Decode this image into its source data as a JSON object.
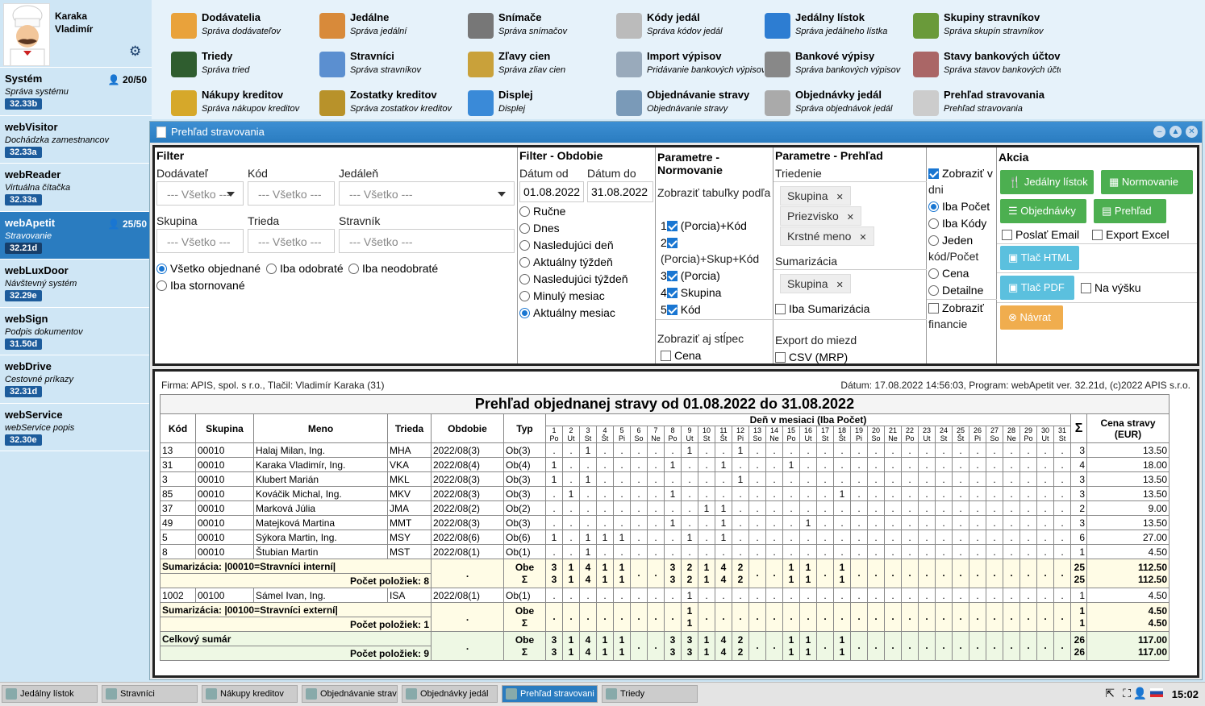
{
  "user": {
    "name1": "Karaka",
    "name2": "Vladimír"
  },
  "systems": [
    {
      "title": "Systém",
      "desc": "Správa systému",
      "ver": "32.33b",
      "count": "20/50"
    },
    {
      "title": "webVisitor",
      "desc": "Dochádzka zamestnancov",
      "ver": "32.33a",
      "count": ""
    },
    {
      "title": "webReader",
      "desc": "Virtuálna čítačka",
      "ver": "32.33a",
      "count": ""
    },
    {
      "title": "webApetit",
      "desc": "Stravovanie",
      "ver": "32.21d",
      "count": "25/50"
    },
    {
      "title": "webLuxDoor",
      "desc": "Návštevný systém",
      "ver": "32.29e",
      "count": ""
    },
    {
      "title": "webSign",
      "desc": "Podpis dokumentov",
      "ver": "31.50d",
      "count": ""
    },
    {
      "title": "webDrive",
      "desc": "Cestovné príkazy",
      "ver": "32.31d",
      "count": ""
    },
    {
      "title": "webService",
      "desc": "webService popis",
      "ver": "32.30e",
      "count": ""
    }
  ],
  "menu": [
    {
      "t": "Dodávatelia",
      "s": "Správa dodávateľov",
      "c": "#e9a23b"
    },
    {
      "t": "Jedálne",
      "s": "Správa jedální",
      "c": "#d88a3a"
    },
    {
      "t": "Snímače",
      "s": "Správa snímačov",
      "c": "#777"
    },
    {
      "t": "Kódy jedál",
      "s": "Správa kódov jedál",
      "c": "#bbb"
    },
    {
      "t": "Jedálny lístok",
      "s": "Správa jedálneho lístka",
      "c": "#2d7dd2"
    },
    {
      "t": "Skupiny stravníkov",
      "s": "Správa skupín stravníkov",
      "c": "#6a9a3a"
    },
    {
      "t": "Triedy",
      "s": "Správa tried",
      "c": "#2f5d2f"
    },
    {
      "t": "Stravníci",
      "s": "Správa stravníkov",
      "c": "#5b8fd0"
    },
    {
      "t": "Zľavy cien",
      "s": "Správa zliav cien",
      "c": "#c9a13a"
    },
    {
      "t": "Import výpisov",
      "s": "Pridávanie bankových výpisov",
      "c": "#9ab"
    },
    {
      "t": "Bankové výpisy",
      "s": "Správa bankových výpisov",
      "c": "#888"
    },
    {
      "t": "Stavy bankových účtov",
      "s": "Správa stavov bankových účtov",
      "c": "#a66"
    },
    {
      "t": "Nákupy kreditov",
      "s": "Správa nákupov kreditov",
      "c": "#d6a82a"
    },
    {
      "t": "Zostatky kreditov",
      "s": "Správa zostatkov kreditov",
      "c": "#b8922a"
    },
    {
      "t": "Displej",
      "s": "Displej",
      "c": "#3a8ad8"
    },
    {
      "t": "Objednávanie stravy",
      "s": "Objednávanie stravy",
      "c": "#7a9ab8"
    },
    {
      "t": "Objednávky jedál",
      "s": "Správa objednávok jedál",
      "c": "#aaa"
    },
    {
      "t": "Prehľad stravovania",
      "s": "Prehľad stravovania",
      "c": "#ccc"
    }
  ],
  "window": {
    "title": "Prehľad stravovania"
  },
  "filter": {
    "header": "Filter",
    "l_dod": "Dodávateľ",
    "l_kod": "Kód",
    "l_jed": "Jedáleň",
    "l_skup": "Skupina",
    "l_trieda": "Trieda",
    "l_strav": "Stravník",
    "all": "--- Všetko ---",
    "r1": "Všetko objednané",
    "r2": "Iba odobraté",
    "r3": "Iba neodobraté",
    "r4": "Iba stornované"
  },
  "obdobie": {
    "header": "Filter - Obdobie",
    "l_od": "Dátum od",
    "l_do": "Dátum do",
    "od": "01.08.2022",
    "do": "31.08.2022",
    "opts": [
      "Ručne",
      "Dnes",
      "Nasledujúci deň",
      "Aktuálny týždeň",
      "Nasledujúci týždeň",
      "Minulý mesiac",
      "Aktuálny mesiac"
    ]
  },
  "norm": {
    "header1": "Parametre -",
    "header2": "Normovanie",
    "l_tab": "Zobraziť tabuľky podľa",
    "o1": "(Porcia)+Kód",
    "o2": "(Porcia)+Skup+Kód",
    "o3": "(Porcia)",
    "o4": "Skupina",
    "o5": "Kód",
    "l_stlpec": "Zobraziť aj stĺpec",
    "cena": "Cena"
  },
  "prehlad": {
    "header": "Parametre - Prehľad",
    "l_tried": "Triedenie",
    "tags": [
      "Skupina",
      "Priezvisko",
      "Krstné meno"
    ],
    "l_sum": "Sumarizácia",
    "sumtag": "Skupina",
    "iba_sum": "Iba Sumarizácia",
    "l_export": "Export do miezd",
    "csv": "CSV (MRP)",
    "zobr_dni1": "Zobraziť v",
    "zobr_dni2": "dni",
    "iba_pocet": "Iba Počet",
    "iba_kody": "Iba Kódy",
    "jeden1": "Jeden",
    "jeden2": "kód/Počet",
    "cena": "Cena",
    "detailne": "Detailne",
    "fin1": "Zobraziť",
    "fin2": "financie"
  },
  "akcia": {
    "header": "Akcia",
    "b1": "Jedálny lístok",
    "b2": "Normovanie",
    "b3": "Objednávky",
    "b4": "Prehľad",
    "email": "Poslať Email",
    "excel": "Export Excel",
    "html": "Tlač HTML",
    "pdf": "Tlač PDF",
    "vysku": "Na výšku",
    "navrat": "Návrat"
  },
  "report": {
    "firma": "Firma: APIS, spol. s r.o., Tlačil: Vladimír Karaka (31)",
    "datum": "Dátum: 17.08.2022 14:56:03, Program: webApetit ver. 32.21d, (c)2022 APIS s.r.o.",
    "title": "Prehľad objednanej stravy od 01.08.2022 do 31.08.2022",
    "h_kod": "Kód",
    "h_skup": "Skupina",
    "h_meno": "Meno",
    "h_trieda": "Trieda",
    "h_obd": "Obdobie",
    "h_typ": "Typ",
    "h_den": "Deň v mesiaci (Iba Počet)",
    "h_sigma": "Σ",
    "h_cena": "Cena stravy (EUR)",
    "daynums": [
      "1",
      "2",
      "3",
      "4",
      "5",
      "6",
      "7",
      "8",
      "9",
      "10",
      "11",
      "12",
      "13",
      "14",
      "15",
      "16",
      "17",
      "18",
      "19",
      "20",
      "21",
      "22",
      "23",
      "24",
      "25",
      "26",
      "27",
      "28",
      "29",
      "30",
      "31"
    ],
    "daynames": [
      "Po",
      "Ut",
      "St",
      "Št",
      "Pi",
      "So",
      "Ne",
      "Po",
      "Ut",
      "St",
      "Št",
      "Pi",
      "So",
      "Ne",
      "Po",
      "Ut",
      "St",
      "Št",
      "Pi",
      "So",
      "Ne",
      "Po",
      "Ut",
      "St",
      "Št",
      "Pi",
      "So",
      "Ne",
      "Po",
      "Ut",
      "St"
    ],
    "rows": [
      {
        "kod": "13",
        "skup": "00010",
        "meno": "Halaj Milan, Ing.",
        "trieda": "MHA",
        "obd": "2022/08(3)",
        "typ": "Ob(3)",
        "days": {
          "3": "1",
          "9": "1",
          "12": "1"
        },
        "sum": "3",
        "cena": "13.50"
      },
      {
        "kod": "31",
        "skup": "00010",
        "meno": "Karaka Vladimír, Ing.",
        "trieda": "VKA",
        "obd": "2022/08(4)",
        "typ": "Ob(4)",
        "days": {
          "1": "1",
          "8": "1",
          "11": "1",
          "15": "1"
        },
        "sum": "4",
        "cena": "18.00"
      },
      {
        "kod": "3",
        "skup": "00010",
        "meno": "Klubert Marián",
        "trieda": "MKL",
        "obd": "2022/08(3)",
        "typ": "Ob(3)",
        "days": {
          "1": "1",
          "3": "1",
          "12": "1"
        },
        "sum": "3",
        "cena": "13.50"
      },
      {
        "kod": "85",
        "skup": "00010",
        "meno": "Kováčik Michal, Ing.",
        "trieda": "MKV",
        "obd": "2022/08(3)",
        "typ": "Ob(3)",
        "days": {
          "2": "1",
          "8": "1",
          "18": "1"
        },
        "sum": "3",
        "cena": "13.50"
      },
      {
        "kod": "37",
        "skup": "00010",
        "meno": "Marková Júlia",
        "trieda": "JMA",
        "obd": "2022/08(2)",
        "typ": "Ob(2)",
        "days": {
          "10": "1",
          "11": "1"
        },
        "sum": "2",
        "cena": "9.00"
      },
      {
        "kod": "49",
        "skup": "00010",
        "meno": "Matejková Martina",
        "trieda": "MMT",
        "obd": "2022/08(3)",
        "typ": "Ob(3)",
        "days": {
          "8": "1",
          "11": "1",
          "16": "1"
        },
        "sum": "3",
        "cena": "13.50"
      },
      {
        "kod": "5",
        "skup": "00010",
        "meno": "Sýkora Martin, Ing.",
        "trieda": "MSY",
        "obd": "2022/08(6)",
        "typ": "Ob(6)",
        "days": {
          "1": "1",
          "3": "1",
          "4": "1",
          "5": "1",
          "9": "1",
          "11": "1"
        },
        "sum": "6",
        "cena": "27.00"
      },
      {
        "kod": "8",
        "skup": "00010",
        "meno": "Štubian Martin",
        "trieda": "MST",
        "obd": "2022/08(1)",
        "typ": "Ob(1)",
        "days": {
          "3": "1"
        },
        "sum": "1",
        "cena": "4.50"
      }
    ],
    "sum1": {
      "label": "Sumarizácia: |00010=Stravníci interní|",
      "count": "Počet položiek: 8",
      "typ1": "Obe",
      "typ2": "Σ",
      "d1": {
        "1": "3",
        "2": "1",
        "3": "4",
        "4": "1",
        "5": "1",
        "8": "3",
        "9": "2",
        "10": "1",
        "11": "4",
        "12": "2",
        "15": "1",
        "16": "1",
        "18": "1"
      },
      "d2": {
        "1": "3",
        "2": "1",
        "3": "4",
        "4": "1",
        "5": "1",
        "8": "3",
        "9": "2",
        "10": "1",
        "11": "4",
        "12": "2",
        "15": "1",
        "16": "1",
        "18": "1"
      },
      "s1": "25",
      "s2": "25",
      "c1": "112.50",
      "c2": "112.50"
    },
    "row2": {
      "kod": "1002",
      "skup": "00100",
      "meno": "Sámel Ivan, Ing.",
      "trieda": "ISA",
      "obd": "2022/08(1)",
      "typ": "Ob(1)",
      "days": {
        "9": "1"
      },
      "sum": "1",
      "cena": "4.50"
    },
    "sum2": {
      "label": "Sumarizácia: |00100=Stravníci externí|",
      "count": "Počet položiek: 1",
      "typ1": "Obe",
      "typ2": "Σ",
      "d1": {
        "9": "1"
      },
      "d2": {
        "9": "1"
      },
      "s1": "1",
      "s2": "1",
      "c1": "4.50",
      "c2": "4.50"
    },
    "total": {
      "label": "Celkový sumár",
      "count": "Počet položiek: 9",
      "typ1": "Obe",
      "typ2": "Σ",
      "d1": {
        "1": "3",
        "2": "1",
        "3": "4",
        "4": "1",
        "5": "1",
        "8": "3",
        "9": "3",
        "10": "1",
        "11": "4",
        "12": "2",
        "15": "1",
        "16": "1",
        "18": "1"
      },
      "d2": {
        "1": "3",
        "2": "1",
        "3": "4",
        "4": "1",
        "5": "1",
        "8": "3",
        "9": "3",
        "10": "1",
        "11": "4",
        "12": "2",
        "15": "1",
        "16": "1",
        "18": "1"
      },
      "s1": "26",
      "s2": "26",
      "c1": "117.00",
      "c2": "117.00"
    }
  },
  "taskbar": [
    {
      "label": "Jedálny lístok",
      "active": false
    },
    {
      "label": "Stravníci",
      "active": false
    },
    {
      "label": "Nákupy kreditov",
      "active": false
    },
    {
      "label": "Objednávanie strav",
      "active": false
    },
    {
      "label": "Objednávky jedál",
      "active": false
    },
    {
      "label": "Prehľad stravovani",
      "active": true
    },
    {
      "label": "Triedy",
      "active": false
    }
  ],
  "clock": "15:02"
}
